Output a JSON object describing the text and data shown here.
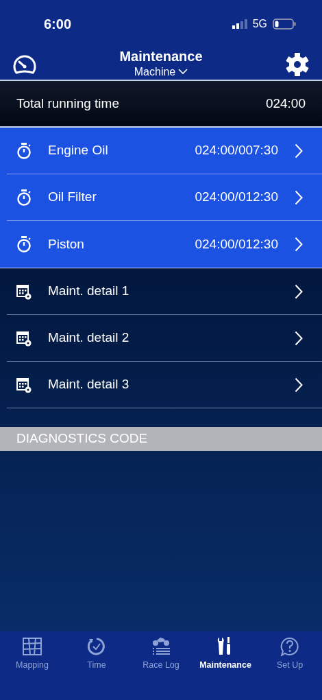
{
  "status_bar": {
    "time": "6:00",
    "network": "5G"
  },
  "header": {
    "title": "Maintenance",
    "subtitle": "Machine"
  },
  "total": {
    "label": "Total running time",
    "value": "024:00"
  },
  "counters": [
    {
      "label": "Engine Oil",
      "value": "024:00/007:30"
    },
    {
      "label": "Oil Filter",
      "value": "024:00/012:30"
    },
    {
      "label": "Piston",
      "value": "024:00/012:30"
    }
  ],
  "details": [
    {
      "label": "Maint. detail 1"
    },
    {
      "label": "Maint. detail 2"
    },
    {
      "label": "Maint. detail 3"
    }
  ],
  "section": {
    "title": "DIAGNOSTICS CODE"
  },
  "tabs": [
    {
      "label": "Mapping",
      "kind": "map",
      "selected": false
    },
    {
      "label": "Time",
      "kind": "clock",
      "selected": false
    },
    {
      "label": "Race Log",
      "kind": "bike",
      "selected": false
    },
    {
      "label": "Maintenance",
      "kind": "tools",
      "selected": true
    },
    {
      "label": "Set Up",
      "kind": "help",
      "selected": false
    }
  ]
}
